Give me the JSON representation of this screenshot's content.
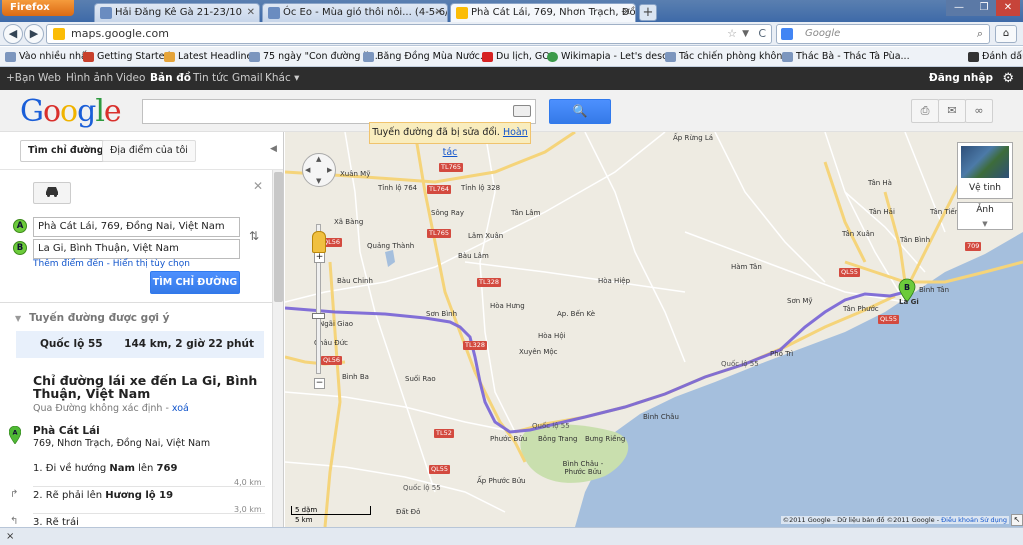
{
  "browser": {
    "firefox_label": "Firefox",
    "tabs": [
      {
        "title": "Hải Đăng Kê Gà 21-23/10"
      },
      {
        "title": "Óc Eo - Mùa gió thôi nôi... (4-5-6/11..."
      },
      {
        "title": "Phà Cát Lái, 769, Nhơn Trạch, Đồng ..."
      }
    ],
    "url": "maps.google.com",
    "search_placeholder": "Google",
    "bookmarks": [
      "Vào nhiều nhất",
      "Getting Started",
      "Latest Headlines",
      "75 ngày \"Con đường li...",
      "Băng Đồng Mùa Nước...",
      "Du lịch, GO!",
      "Wikimapia - Let's desc...",
      "Tác chiến phòng khôn...",
      "Thác Bà - Thác Tà Pùa..."
    ],
    "bookmarks_right": "Đánh dấu"
  },
  "gbar": {
    "links": [
      "+Bạn",
      "Web",
      "Hình ảnh",
      "Video",
      "Bản đồ",
      "Tin tức",
      "Gmail",
      "Khác ▾"
    ],
    "signin": "Đăng nhập"
  },
  "header": {
    "search_button": "🔍"
  },
  "notice": {
    "text": "Tuyến đường đã bị sửa đổi.",
    "undo": "Hoàn tác"
  },
  "left": {
    "tab_directions": "Tìm chỉ đường",
    "tab_my_places": "Địa điểm của tôi",
    "marker_a": "A",
    "marker_b": "B",
    "origin": "Phà Cát Lái, 769, Đồng Nai, Việt Nam",
    "destination": "La Gi, Bình Thuận, Việt Nam",
    "add_destination": "Thêm điểm đến",
    "show_options": "Hiển thị tùy chọn",
    "get_directions": "TÌM CHỈ ĐƯỜNG",
    "suggested": "Tuyến đường được gợi ý",
    "route_name": "Quốc lộ 55",
    "route_info": "144 km, 2 giờ 22 phút",
    "directions_title": "Chỉ đường lái xe đến La Gi, Bình Thuận, Việt Nam",
    "via_text": "Qua Đường không xác định",
    "via_remove": "xoá",
    "start_name": "Phà Cát Lái",
    "start_addr": "769, Nhơn Trạch, Đồng Nai, Việt Nam",
    "steps": [
      {
        "num": "1.",
        "pre": "Đi về hướng ",
        "b1": "Nam",
        "mid": " lên ",
        "b2": "769",
        "dist": "4,0 km"
      },
      {
        "num": "2.",
        "pre": "Rẽ phải lên ",
        "b1": "Hương lộ 19",
        "mid": "",
        "b2": "",
        "dist": "3,0 km"
      },
      {
        "num": "3.",
        "pre": "Rẽ trái",
        "b1": "",
        "mid": "",
        "b2": "",
        "dist": ""
      }
    ]
  },
  "map": {
    "satellite": "Vệ tinh",
    "terrain": "Ảnh",
    "scale_mi": "5 dặm",
    "scale_km": "5 km",
    "copyright": "©2011 Google - Dữ liệu bản đồ ©2011 Google -",
    "terms": "Điều khoản Sử dụng",
    "labels": [
      {
        "text": "Xuân Mỹ"
      },
      {
        "text": "Tỉnh lộ 764"
      },
      {
        "text": "Tỉnh lộ 328"
      },
      {
        "text": "Sông Ray"
      },
      {
        "text": "Tân Lâm"
      },
      {
        "text": "Lâm Xuân"
      },
      {
        "text": "Bàu Lâm"
      },
      {
        "text": "Xã Bàng"
      },
      {
        "text": "Quảng Thành"
      },
      {
        "text": "Bàu Chinh"
      },
      {
        "text": "Hòa Hưng"
      },
      {
        "text": "Hòa Hiệp"
      },
      {
        "text": "Sơn Bình"
      },
      {
        "text": "Ngãi Giao"
      },
      {
        "text": "Châu Đức"
      },
      {
        "text": "Xuyên Mộc"
      },
      {
        "text": "Ap. Bến Kè"
      },
      {
        "text": "Hòa Hội"
      },
      {
        "text": "Bình Ba"
      },
      {
        "text": "Suối Rao"
      },
      {
        "text": "Bình Châu"
      },
      {
        "text": "Bông Trang"
      },
      {
        "text": "Bưng Riềng"
      },
      {
        "text": "Phước Bửu"
      },
      {
        "text": "Ấp Phước Bửu"
      },
      {
        "text": "Đất Đỏ"
      },
      {
        "text": "Hàm Tân"
      },
      {
        "text": "Tân Xuân"
      },
      {
        "text": "Tân Bình"
      },
      {
        "text": "Tân Hà"
      },
      {
        "text": "Sơn Mỹ"
      },
      {
        "text": "Tân Phước"
      },
      {
        "text": "Phố Trì"
      },
      {
        "text": "Tân Tiến"
      },
      {
        "text": "Tân Hải"
      },
      {
        "text": "Bình Tân"
      },
      {
        "text": "La Gi"
      },
      {
        "text": "Ấp Rừng Lá"
      },
      {
        "text": "Bình Châu - Phước Bửu"
      }
    ],
    "roads": [
      "TL765",
      "TL764",
      "TL765",
      "TL328",
      "TL328",
      "TL52",
      "QL55",
      "QL55",
      "QL55",
      "709",
      "QL56",
      "QL56",
      "Quốc lộ 55",
      "Quốc lộ 55",
      "Quốc lộ 55"
    ]
  },
  "bottom": {
    "close": "×"
  }
}
